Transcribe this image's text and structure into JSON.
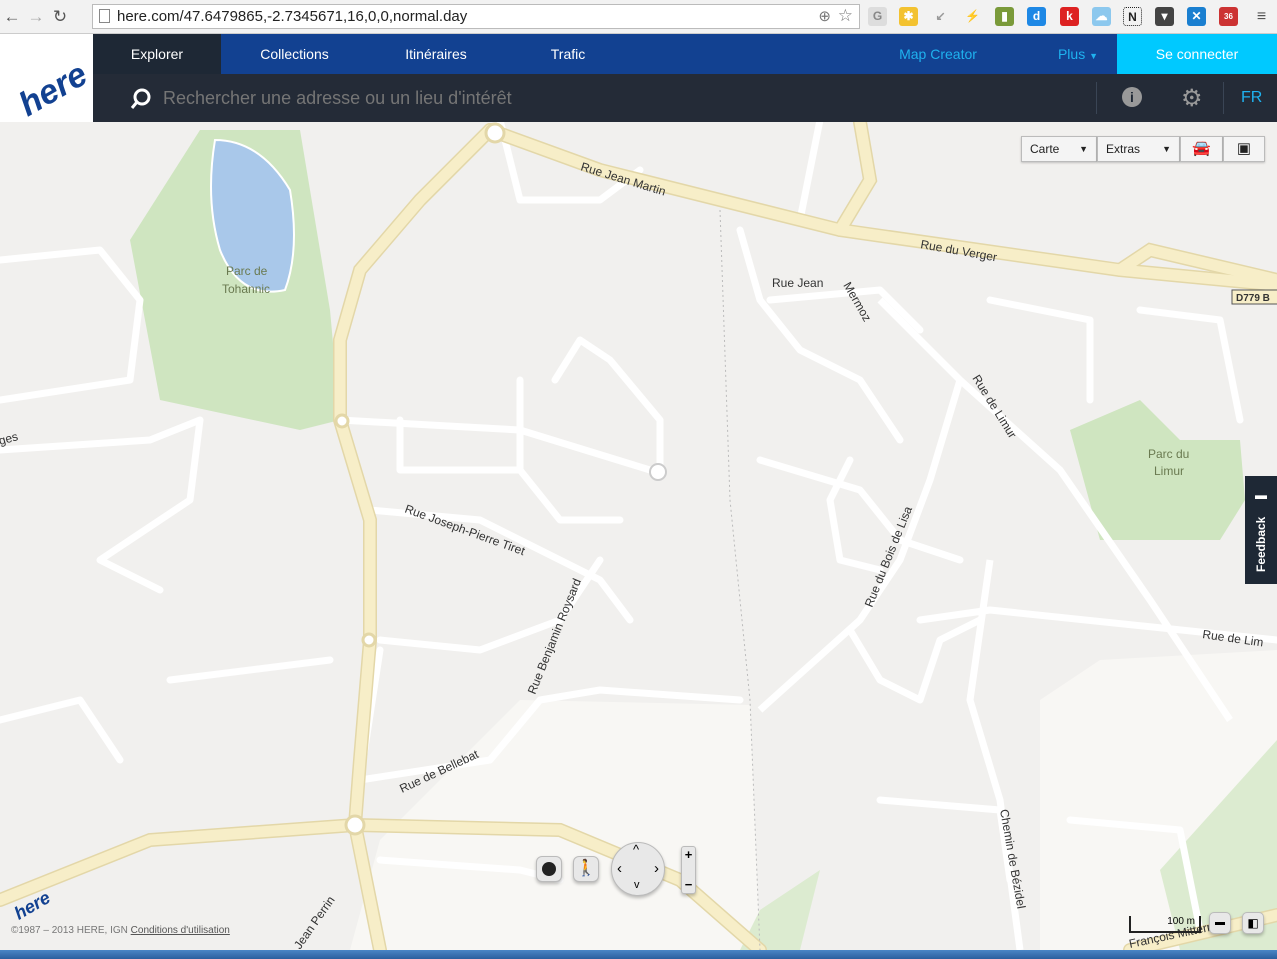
{
  "browser": {
    "url": "here.com/47.6479865,-2.7345671,16,0,0,normal.day",
    "ext_badge": "36"
  },
  "brand": {
    "logo": "here"
  },
  "nav": {
    "tabs": [
      {
        "label": "Explorer",
        "active": true
      },
      {
        "label": "Collections"
      },
      {
        "label": "Itinéraires"
      },
      {
        "label": "Trafic"
      }
    ],
    "map_creator": "Map Creator",
    "plus": "Plus",
    "login": "Se connecter"
  },
  "search": {
    "placeholder": "Rechercher une adresse ou un lieu d'intérêt",
    "lang": "FR"
  },
  "map_controls": {
    "carte": "Carte",
    "extras": "Extras",
    "feedback": "Feedback",
    "scale": "100 m"
  },
  "map_labels": {
    "rue_jean_martin": "Rue Jean  Martin",
    "rue_du_verger": "Rue du  Verger",
    "d779": "D779 B",
    "parc_tohannic_1": "Parc de",
    "parc_tohannic_2": "Tohannic",
    "rue_jean_mermoz_1": "Rue Jean",
    "rue_jean_mermoz_2": "Mermoz",
    "rue_de_limur": "Rue de Limur",
    "parc_limur_1": "Parc du",
    "parc_limur_2": "Limur",
    "rue_jp_tiret": "Rue Joseph-Pierre  Tiret",
    "rue_b_roysard": "Rue  Benjamin Roysard",
    "rue_bois_lisa": "Rue du Bois de Lisa",
    "rue_de_lim": "Rue de Lim",
    "rue_bellebat": "Rue de Bellebat",
    "chemin_bezidel": "Chemin de Bézidel",
    "jean_perrin": "Jean Perrin",
    "francois": "François  Mitterrand",
    "ges": "ges"
  },
  "footer": {
    "copyright": "©1987 – 2013 HERE, IGN",
    "terms": "Conditions d'utilisation"
  },
  "colors": {
    "nav": "#124191",
    "login": "#00c9ff",
    "search": "#18202c",
    "map_bg": "#f1f0ee",
    "road_major": "#f7eec8",
    "park": "#cfe5c0",
    "water": "#a9c8ea"
  }
}
